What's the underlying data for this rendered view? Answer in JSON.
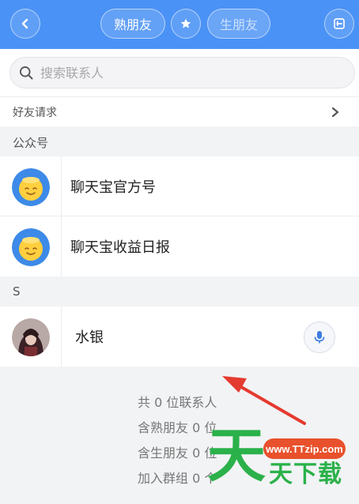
{
  "header": {
    "tab_active": "熟朋友",
    "tab_inactive": "生朋友",
    "back_icon": "chevron-left-icon",
    "star_icon": "star-icon",
    "scan_icon": "scan-icon"
  },
  "search": {
    "placeholder": "搜索联系人"
  },
  "friend_requests": {
    "label": "好友请求"
  },
  "sections": [
    {
      "label": "公众号"
    },
    {
      "label": "S"
    }
  ],
  "official_accounts": [
    {
      "name": "聊天宝官方号"
    },
    {
      "name": "聊天宝收益日报"
    }
  ],
  "contacts": [
    {
      "name": "水银"
    }
  ],
  "stats": [
    "共 0 位联系人",
    "含熟朋友 0 位",
    "含生朋友 0 位",
    "加入群组 0 个"
  ],
  "watermark": {
    "url": "www.TTzip.com",
    "big": "天",
    "small": "天下载"
  },
  "colors": {
    "header_blue": "#4a92f5",
    "accent_red": "#e53a30",
    "watermark_green": "#2bb14a"
  }
}
